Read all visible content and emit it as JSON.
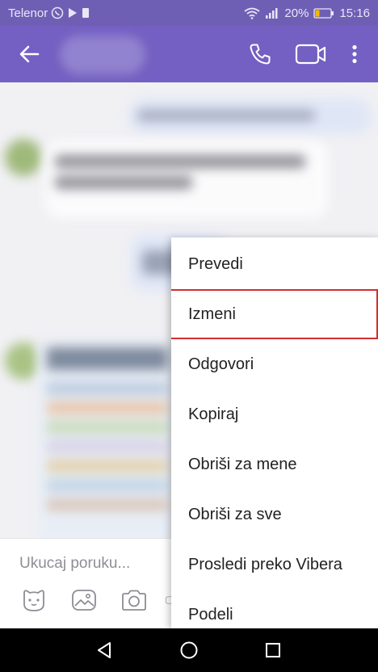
{
  "status_bar": {
    "carrier": "Telenor",
    "battery": "20%",
    "time": "15:16",
    "icons": [
      "viber-icon",
      "play-icon",
      "sim-icon",
      "wifi-icon",
      "signal-icon",
      "battery-icon"
    ]
  },
  "app_bar": {
    "icons": [
      "back-arrow-icon",
      "phone-icon",
      "video-camera-icon",
      "more-vertical-icon"
    ]
  },
  "input_bar": {
    "placeholder": "Ukucaj poruku...",
    "tools": [
      "sticker-icon",
      "gallery-icon",
      "camera-icon"
    ]
  },
  "context_menu": {
    "items": [
      {
        "label": "Prevedi",
        "highlighted": false
      },
      {
        "label": "Izmeni",
        "highlighted": true
      },
      {
        "label": "Odgovori",
        "highlighted": false
      },
      {
        "label": "Kopiraj",
        "highlighted": false
      },
      {
        "label": "Obriši za mene",
        "highlighted": false
      },
      {
        "label": "Obriši za sve",
        "highlighted": false
      },
      {
        "label": "Prosledi preko Vibera",
        "highlighted": false
      },
      {
        "label": "Podeli",
        "highlighted": false
      }
    ]
  },
  "nav_bar": {
    "icons": [
      "back-triangle-icon",
      "home-circle-icon",
      "recents-square-icon"
    ]
  },
  "colors": {
    "app_bar": "#7360c2",
    "status_bar": "#6f5fb4",
    "highlight_outline": "#d22e2e",
    "menu_text": "#222222"
  }
}
